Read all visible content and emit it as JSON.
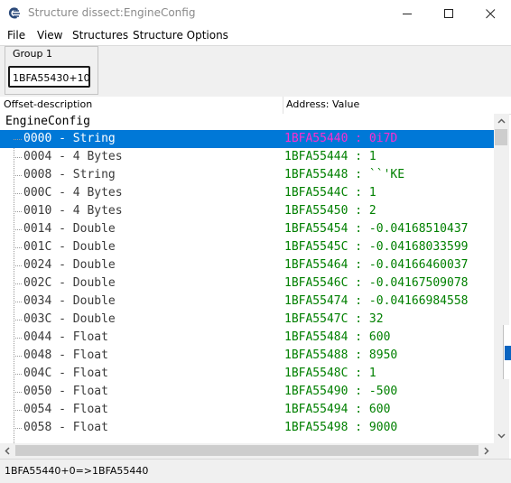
{
  "window": {
    "title": "Structure dissect:EngineConfig"
  },
  "menu": [
    "File",
    "View",
    "Structures",
    "Structure Options"
  ],
  "group": {
    "label": "Group 1",
    "address": "1BFA55430+10"
  },
  "columns": {
    "offset_description": "Offset-description",
    "address_value": "Address: Value"
  },
  "tree": {
    "root": "EngineConfig",
    "rows": [
      {
        "label": "0000 - String",
        "value": "1BFA55440 : 0i7D",
        "selected": true
      },
      {
        "label": "0004 - 4 Bytes",
        "value": "1BFA55444 : 1"
      },
      {
        "label": "0008 - String",
        "value": "1BFA55448 : ``'KE"
      },
      {
        "label": "000C - 4 Bytes",
        "value": "1BFA5544C : 1"
      },
      {
        "label": "0010 - 4 Bytes",
        "value": "1BFA55450 : 2"
      },
      {
        "label": "0014 - Double",
        "value": "1BFA55454 : -0.04168510437"
      },
      {
        "label": "001C - Double",
        "value": "1BFA5545C : -0.04168033599"
      },
      {
        "label": "0024 - Double",
        "value": "1BFA55464 : -0.04166460037"
      },
      {
        "label": "002C - Double",
        "value": "1BFA5546C : -0.04167509078"
      },
      {
        "label": "0034 - Double",
        "value": "1BFA55474 : -0.04166984558"
      },
      {
        "label": "003C - Double",
        "value": "1BFA5547C : 32"
      },
      {
        "label": "0044 - Float",
        "value": "1BFA55484 : 600"
      },
      {
        "label": "0048 - Float",
        "value": "1BFA55488 : 8950"
      },
      {
        "label": "004C - Float",
        "value": "1BFA5548C : 1"
      },
      {
        "label": "0050 - Float",
        "value": "1BFA55490 : -500"
      },
      {
        "label": "0054 - Float",
        "value": "1BFA55494 : 600"
      },
      {
        "label": "0058 - Float",
        "value": "1BFA55498 : 9000"
      }
    ]
  },
  "status": {
    "text": "1BFA55440+0=>1BFA55440"
  },
  "colors": {
    "selection": "#0078d7",
    "selected_value": "#ff2ccf",
    "value_text": "#008000"
  },
  "icons": [
    "cheat-engine-logo-icon",
    "minimize-icon",
    "maximize-icon",
    "close-icon",
    "scroll-up-arrow-icon",
    "scroll-down-arrow-icon",
    "scroll-left-arrow-icon",
    "scroll-right-arrow-icon"
  ]
}
